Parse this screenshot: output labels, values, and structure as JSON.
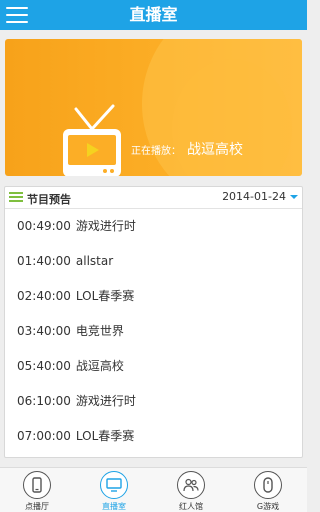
{
  "header": {
    "title": "直播室",
    "menu_icon": "hamburger-menu-icon"
  },
  "banner": {
    "now_playing_label": "正在播放：",
    "current_show": "战逗高校",
    "icon": "tv-play-icon",
    "colors": {
      "background": "#fcae26",
      "screen": "#fcae26",
      "play": "#f5c21f"
    }
  },
  "schedule": {
    "title": "节目预告",
    "date": "2014-01-24",
    "items": [
      {
        "time": "00:49:00",
        "name": "游戏进行时"
      },
      {
        "time": "01:40:00",
        "name": "allstar"
      },
      {
        "time": "02:40:00",
        "name": "LOL春季赛"
      },
      {
        "time": "03:40:00",
        "name": "电竞世界"
      },
      {
        "time": "05:40:00",
        "name": "战逗高校"
      },
      {
        "time": "06:10:00",
        "name": "游戏进行时"
      },
      {
        "time": "07:00:00",
        "name": "LOL春季赛"
      }
    ]
  },
  "nav": {
    "items": [
      {
        "label": "点播厅",
        "icon": "phone-icon",
        "active": false
      },
      {
        "label": "直播室",
        "icon": "monitor-icon",
        "active": true
      },
      {
        "label": "红人馆",
        "icon": "people-icon",
        "active": false
      },
      {
        "label": "G游戏",
        "icon": "gamepad-icon",
        "active": false
      }
    ]
  },
  "colors": {
    "accent": "#1ea3e6",
    "banner": "#fcae26",
    "list_icon": "#7fbf3f"
  }
}
